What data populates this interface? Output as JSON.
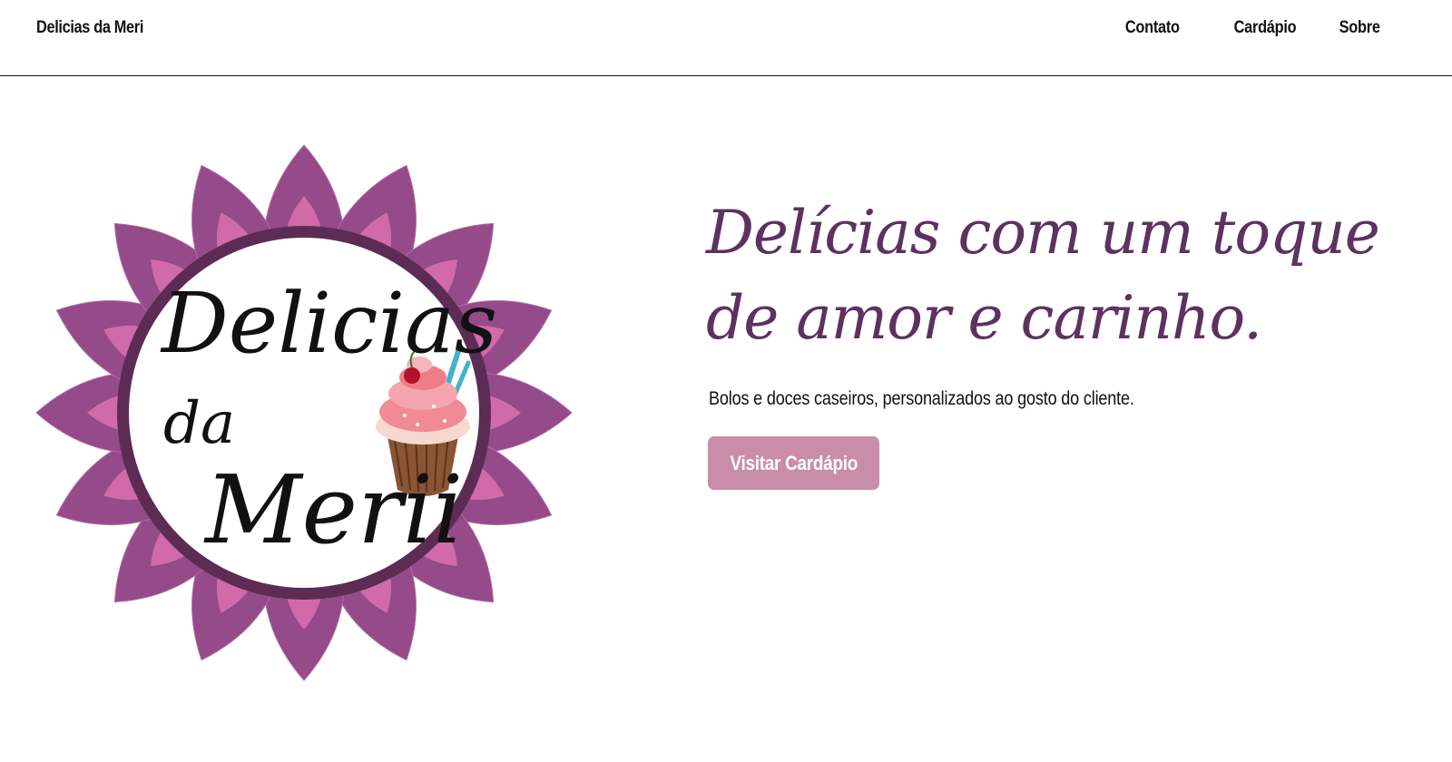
{
  "header": {
    "brand": "Delicias da Meri",
    "nav": [
      {
        "label": "Contato"
      },
      {
        "label": "Cardápio"
      },
      {
        "label": "Sobre"
      }
    ]
  },
  "hero": {
    "title": "Delícias com um toque de amor e carinho.",
    "subtitle": "Bolos e doces caseiros, personalizados ao gosto do cliente.",
    "cta_label": "Visitar Cardápio"
  },
  "logo": {
    "text_line1": "Delicias",
    "text_line2": "da",
    "text_line3": "Merii",
    "petal_color": "#954a8a",
    "petal_inner_color": "#d06aa8",
    "ring_color": "#5c2c55"
  },
  "colors": {
    "accent": "#5e3161",
    "button": "#c98daa"
  }
}
